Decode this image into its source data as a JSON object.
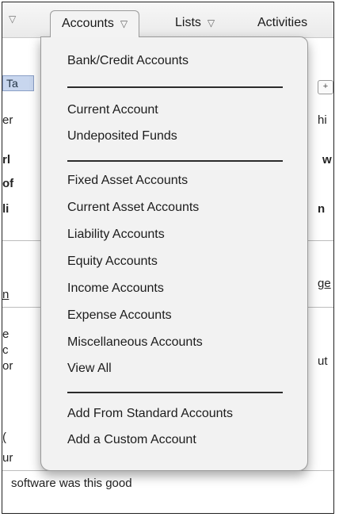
{
  "nav": {
    "items": [
      {
        "label": "Accounts"
      },
      {
        "label": "Lists"
      },
      {
        "label": "Activities"
      }
    ]
  },
  "background": {
    "tab_label": "Ta",
    "fragments": [
      "er",
      "rl",
      "of",
      "li",
      "n",
      "e",
      "c",
      "or",
      "(",
      "ur",
      "hi",
      "w",
      "n",
      "ge",
      "ut"
    ],
    "footer": "software was this good"
  },
  "menu": {
    "groups": [
      [
        "Bank/Credit Accounts"
      ],
      [
        "Current Account",
        "Undeposited Funds"
      ],
      [
        "Fixed Asset Accounts",
        "Current Asset Accounts",
        "Liability Accounts",
        "Equity Accounts",
        "Income Accounts",
        "Expense Accounts",
        "Miscellaneous Accounts",
        "View All"
      ],
      [
        "Add From Standard Accounts",
        "Add a Custom Account"
      ]
    ]
  }
}
